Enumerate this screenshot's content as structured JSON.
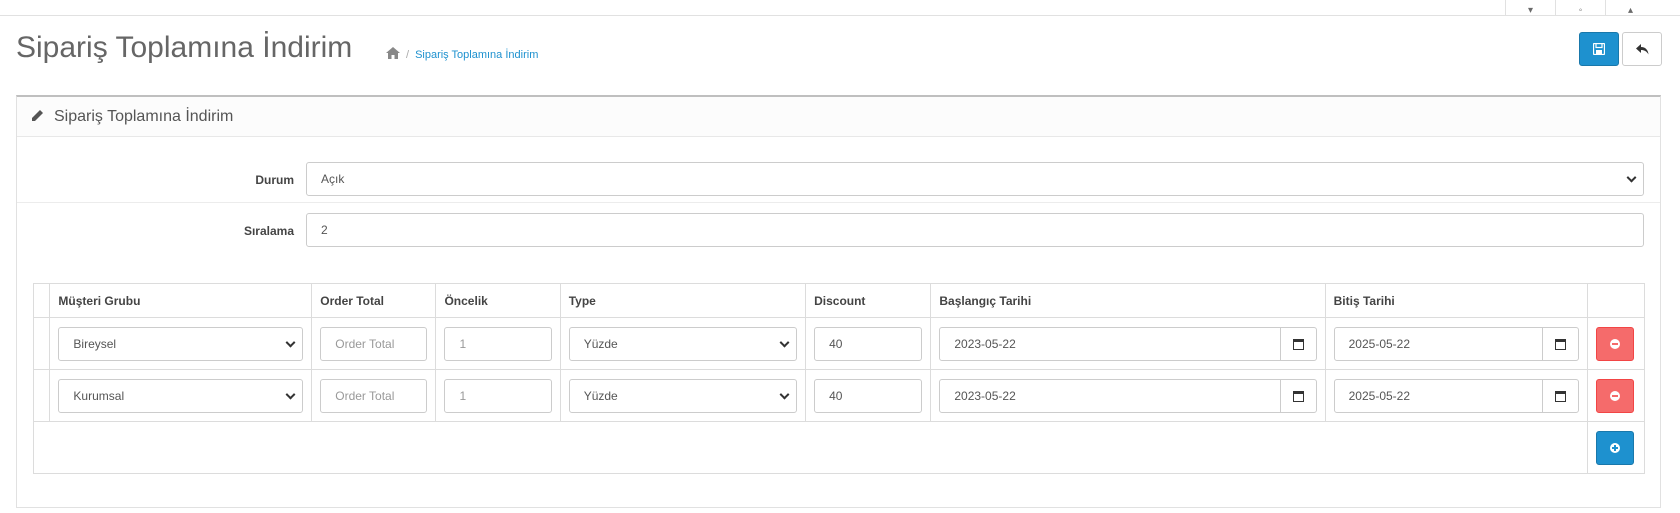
{
  "page": {
    "title": "Sipariş Toplamına İndirim",
    "breadcrumb_current": "Sipariş Toplamına İndirim"
  },
  "panel": {
    "heading": "Sipariş Toplamına İndirim"
  },
  "form": {
    "status_label": "Durum",
    "status_value": "Açık",
    "sort_label": "Sıralama",
    "sort_value": "2"
  },
  "table": {
    "headers": [
      "Müşteri Grubu",
      "Order Total",
      "Öncelik",
      "Type",
      "Discount",
      "Başlangıç Tarihi",
      "Bitiş Tarihi"
    ],
    "rows": [
      {
        "customer_group": "Bireysel",
        "order_total_placeholder": "Order Total",
        "priority": "1",
        "type": "Yüzde",
        "discount": "40",
        "start_date": "2023-05-22",
        "end_date": "2025-05-22"
      },
      {
        "customer_group": "Kurumsal",
        "order_total_placeholder": "Order Total",
        "priority": "1",
        "type": "Yüzde",
        "discount": "40",
        "start_date": "2023-05-22",
        "end_date": "2025-05-22"
      }
    ]
  },
  "icons": {
    "home": "home-icon",
    "save": "save-icon",
    "back": "reply-icon",
    "pencil": "pencil-icon",
    "calendar": "calendar-icon",
    "remove": "minus-circle-icon",
    "add": "plus-circle-icon"
  },
  "colors": {
    "primary": "#1e91cf",
    "danger": "#f56b6b"
  }
}
